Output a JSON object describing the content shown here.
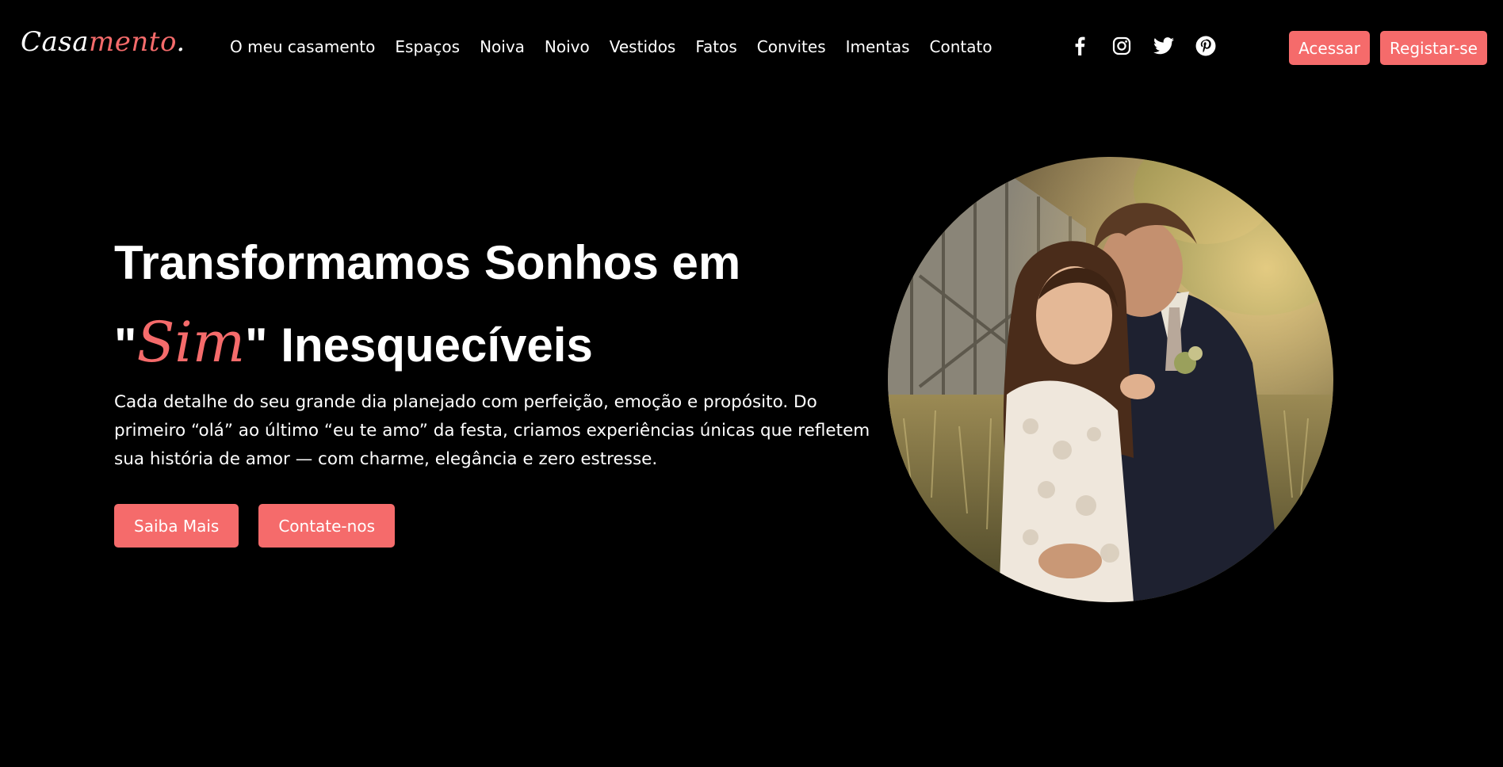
{
  "brand": {
    "logo_part1": "Casa",
    "logo_part2": "mento",
    "logo_part3": ".",
    "accent_color": "#f56b6b"
  },
  "nav": {
    "items": [
      {
        "label": "O meu casamento"
      },
      {
        "label": "Espaços"
      },
      {
        "label": "Noiva"
      },
      {
        "label": "Noivo"
      },
      {
        "label": "Vestidos"
      },
      {
        "label": "Fatos"
      },
      {
        "label": "Convites"
      },
      {
        "label": "Imentas"
      },
      {
        "label": "Contato"
      }
    ]
  },
  "social": {
    "icons": [
      "facebook-icon",
      "instagram-icon",
      "twitter-icon",
      "pinterest-icon"
    ]
  },
  "auth": {
    "login_label": "Acessar",
    "register_label": "Registar-se"
  },
  "hero": {
    "title_line1": "Transformamos Sonhos em",
    "quote_open": "\"",
    "title_accent": "Sim",
    "quote_close_rest": "\" Inesquecíveis",
    "description": "Cada detalhe do seu grande dia planejado com perfeição, emoção e propósito. Do primeiro “olá” ao último “eu te amo” da festa, criamos experiências únicas que refletem sua história de amor — com charme, elegância e zero estresse.",
    "primary_button": "Saiba Mais",
    "secondary_button": "Contate-nos"
  }
}
